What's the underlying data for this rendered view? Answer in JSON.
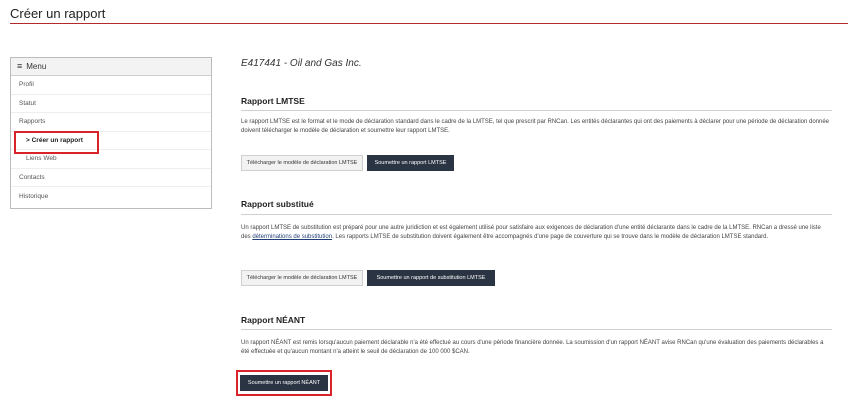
{
  "page": {
    "title": "Créer un rapport"
  },
  "sidebar": {
    "header": "Menu",
    "items": [
      {
        "label": "Profil"
      },
      {
        "label": "Statut"
      },
      {
        "label": "Rapports"
      },
      {
        "label": "> Créer un rapport"
      },
      {
        "label": "Liens Web"
      },
      {
        "label": "Contacts"
      },
      {
        "label": "Historique"
      }
    ]
  },
  "main": {
    "company": "E417441 - Oil and Gas Inc.",
    "sections": [
      {
        "title": "Rapport LMTSE",
        "text": "Le rapport LMTSE est le format et le mode de déclaration standard dans le cadre de la LMTSE, tel que prescrit par RNCan. Les entités déclarantes qui ont des paiements à déclarer pour une période de déclaration donnée doivent télécharger le modèle de déclaration et soumettre leur rapport LMTSE.",
        "buttons": [
          "Télécharger le modèle de déclaration LMTSE",
          "Soumettre un rapport LMTSE"
        ]
      },
      {
        "title": "Rapport substitué",
        "text_before": "Un rapport LMTSE de substitution est préparé pour une autre juridiction et est également utilisé pour satisfaire aux exigences de déclaration d'une entité déclarante dans le cadre de la LMTSE. RNCan a dressé une liste des ",
        "link": "déterminations de substitution",
        "text_after": ". Les rapports LMTSE de substitution doivent également être accompagnés d'une page de couverture qui se trouve dans le modèle de déclaration LMTSE standard.",
        "buttons": [
          "Télécharger le modèle de déclaration LMTSE",
          "Soumettre un rapport de substitution LMTSE"
        ]
      },
      {
        "title": "Rapport NÉANT",
        "text": "Un rapport NÉANT est remis lorsqu'aucun paiement déclarable n'a été effectué au cours d'une période financière donnée. La soumission d'un rapport NÉANT avise RNCan qu'une évaluation des paiements déclarables a été effectuée et qu'aucun montant n'a atteint le seuil de déclaration de 100 000 $CAN.",
        "buttons": [
          "Soumettre un rapport NÉANT"
        ]
      }
    ]
  },
  "colors": {
    "accent": "#b22a2a",
    "highlight": "#d8232a",
    "button_dark": "#2b3442"
  }
}
